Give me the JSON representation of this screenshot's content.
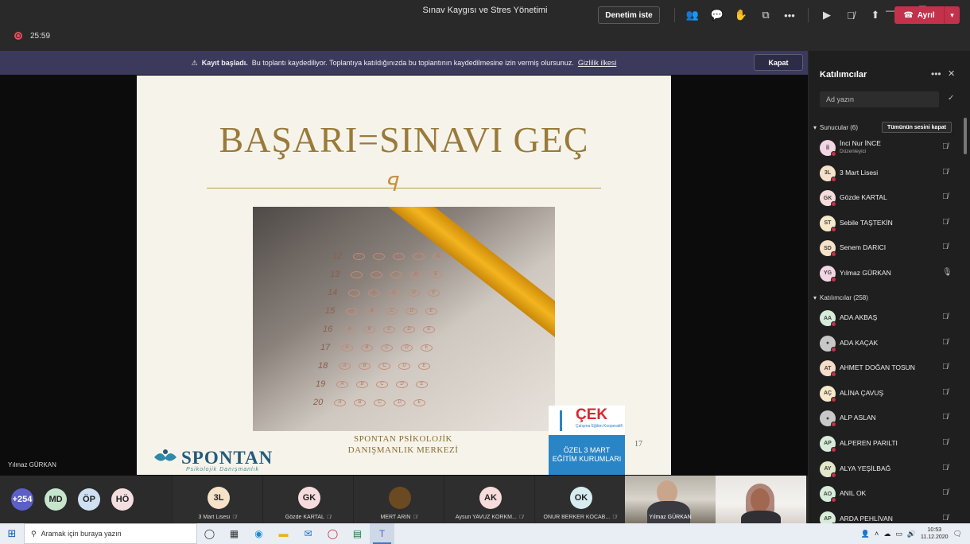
{
  "window": {
    "title": "Sınav Kaygısı ve Stres Yönetimi"
  },
  "toolbar": {
    "timer": "25:59",
    "audit_label": "Denetim iste",
    "leave_label": "Ayrıl"
  },
  "banner": {
    "bold": "Kayıt başladı.",
    "text": "Bu toplantı kaydediliyor. Toplantıya katıldığınızda bu toplantının kaydedilmesine izin vermiş olursunuz.",
    "link": "Gizlilik ilkesi",
    "close_label": "Kapat"
  },
  "slide": {
    "title": "BAŞARI=SINAVI GEÇ",
    "ornament": "ঙ",
    "center_line1": "SPONTAN PSİKOLOJİK",
    "center_line2": "DANIŞMANLIK MERKEZİ",
    "page_number": "17",
    "logo_word": "SPONTAN",
    "logo_sub": "Psikolojik Danışmanlık",
    "cek_title": "ÇEK",
    "cek_sub": "Çalışma Eğitim Kooperatifi",
    "cek_line1": "ÖZEL 3 MART",
    "cek_line2": "EĞİTİM KURUMLARI",
    "sheet_numbers": [
      "12",
      "13",
      "14",
      "15",
      "16",
      "17",
      "18",
      "19",
      "20"
    ]
  },
  "stage": {
    "speaker_name": "Yılmaz GÜRKAN"
  },
  "filmstrip": {
    "avatars": [
      {
        "initials": "+254",
        "color": "#5b5fc7"
      },
      {
        "initials": "MD",
        "color": "#c5e5cd"
      },
      {
        "initials": "ÖP",
        "color": "#cfe0f3"
      },
      {
        "initials": "HÖ",
        "color": "#f3dfe0"
      }
    ],
    "tiles": [
      {
        "initials": "3L",
        "name": "3 Mart Lisesi",
        "color": "#f6e1c9"
      },
      {
        "initials": "GK",
        "name": "Gözde KARTAL",
        "color": "#f6dcdc"
      },
      {
        "initials": "",
        "name": "MERT ARIN",
        "color": "#6b4a22"
      },
      {
        "initials": "AK",
        "name": "Aysun YAVUZ KORKM...",
        "color": "#f6dcdc"
      },
      {
        "initials": "OK",
        "name": "ONUR BERKER KOCAB...",
        "color": "#d7ecef"
      }
    ],
    "video1_name": "Yılmaz GÜRKAN"
  },
  "panel": {
    "title": "Katılımcılar",
    "search_placeholder": "Ad yazın",
    "presenters_header": "Sunucular (6)",
    "mute_all_label": "Tümünün sesini kapat",
    "attendees_header": "Katılımcılar (258)",
    "presenters": [
      {
        "initials": "İİ",
        "name": "İnci Nur İNCE",
        "role": "Düzenleyici",
        "color": "#f2d6e4",
        "mic": "🎙̸"
      },
      {
        "initials": "3L",
        "name": "3 Mart Lisesi",
        "role": "",
        "color": "#f6e1c9",
        "mic": "🎙̸"
      },
      {
        "initials": "GK",
        "name": "Gözde KARTAL",
        "role": "",
        "color": "#f6dcdc",
        "mic": "🎙̸"
      },
      {
        "initials": "ST",
        "name": "Sebile TAŞTEKİN",
        "role": "",
        "color": "#f6e9c9",
        "mic": "🎙̸"
      },
      {
        "initials": "SD",
        "name": "Senem DARICI",
        "role": "",
        "color": "#f6e1c9",
        "mic": "🎙̸"
      },
      {
        "initials": "YG",
        "name": "Yılmaz GÜRKAN",
        "role": "",
        "color": "#f2d6e4",
        "mic": "🎙"
      }
    ],
    "attendees": [
      {
        "initials": "AA",
        "name": "ADA AKBAŞ",
        "color": "#d7ecd9"
      },
      {
        "initials": "",
        "name": "ADA KAÇAK",
        "color": "#c8c8c8"
      },
      {
        "initials": "AT",
        "name": "AHMET DOĞAN TOSUN",
        "color": "#f6dcc9"
      },
      {
        "initials": "AÇ",
        "name": "ALİNA ÇAVUŞ",
        "color": "#f6e9c9"
      },
      {
        "initials": "",
        "name": "ALP ASLAN",
        "color": "#c8c8c8"
      },
      {
        "initials": "AP",
        "name": "ALPEREN PARILTI",
        "color": "#d7ecd9"
      },
      {
        "initials": "AY",
        "name": "ALYA YEŞİLBAĞ",
        "color": "#e2e8c9"
      },
      {
        "initials": "AO",
        "name": "ANIL OK",
        "color": "#d7ecd9"
      },
      {
        "initials": "AP",
        "name": "ARDA PEHLİVAN",
        "color": "#d7ecd9"
      }
    ]
  },
  "taskbar": {
    "search_placeholder": "Aramak için buraya yazın",
    "time": "10:53",
    "date": "11.12.2020"
  }
}
